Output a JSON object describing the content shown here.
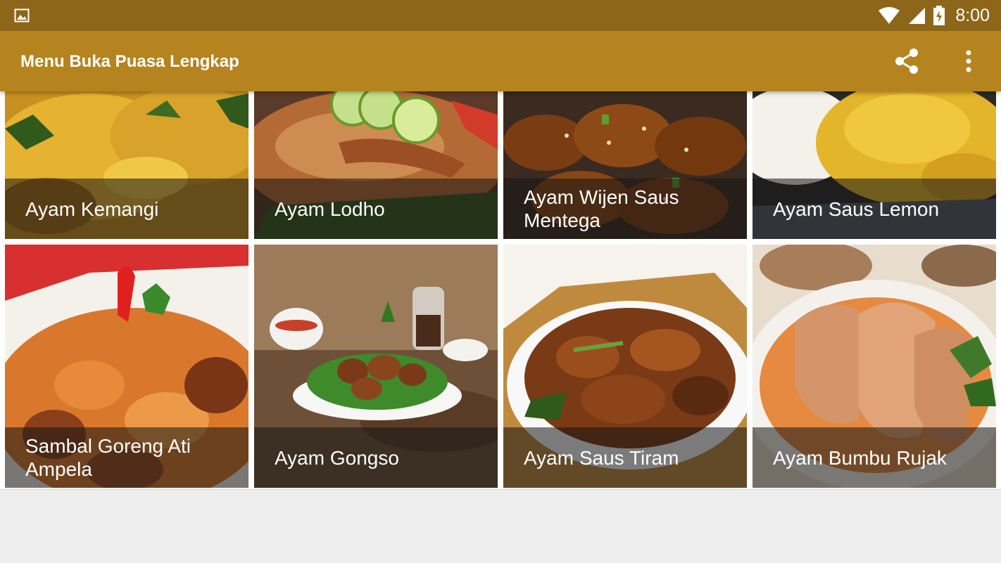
{
  "status_bar": {
    "time": "8:00",
    "icons": [
      "image-notification-icon",
      "wifi-icon",
      "signal-icon",
      "battery-charging-icon"
    ],
    "background": "#8e6619"
  },
  "app_bar": {
    "title": "Menu Buka Puasa Lengkap",
    "background": "#b5841f",
    "actions": [
      "share-icon",
      "more-vert-icon"
    ]
  },
  "recipes": [
    {
      "title": "Ayam Kemangi",
      "palette": [
        "#d8a020",
        "#e9b83a",
        "#2f5a1c"
      ]
    },
    {
      "title": "Ayam Lodho",
      "palette": [
        "#a35a2c",
        "#c98a4b",
        "#8bc34a"
      ]
    },
    {
      "title": "Ayam Wijen Saus Mentega",
      "palette": [
        "#6b3410",
        "#9a5218",
        "#e6d0a0"
      ]
    },
    {
      "title": "Ayam Saus Lemon",
      "palette": [
        "#e2b52a",
        "#f3f1ea",
        "#2a2a2a"
      ]
    },
    {
      "title": "Sambal Goreng Ati Ampela",
      "palette": [
        "#d2782a",
        "#8a3f1b",
        "#d32f2f"
      ]
    },
    {
      "title": "Ayam Gongso",
      "palette": [
        "#7b5a3e",
        "#3f7a2a",
        "#9c6a3c"
      ]
    },
    {
      "title": "Ayam Saus Tiram",
      "palette": [
        "#7a3a16",
        "#c8903a",
        "#f1ede6"
      ]
    },
    {
      "title": "Ayam Bumbu Rujak",
      "palette": [
        "#e08a4a",
        "#c25a22",
        "#f1ece4"
      ]
    }
  ]
}
